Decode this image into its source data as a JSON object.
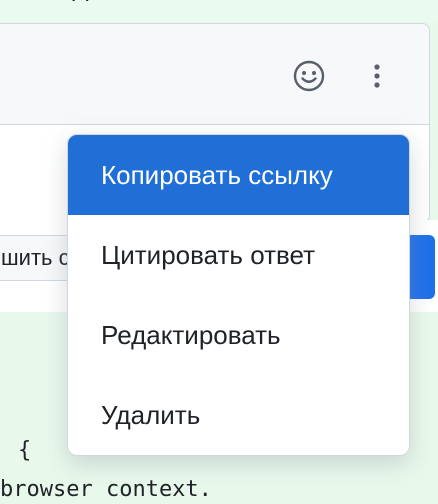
{
  "top_strip": {
    "partial_text": "· ·"
  },
  "comment_header": {
    "emoji_icon": "smiley-icon",
    "more_icon": "kebab-dots-icon"
  },
  "resolve_button": {
    "label": "шить с"
  },
  "code": {
    "line1": "{",
    "line2": "browser context."
  },
  "menu": {
    "items": [
      {
        "label": "Копировать ссылку",
        "active": true
      },
      {
        "label": "Цитировать ответ"
      },
      {
        "label": "Редактировать"
      },
      {
        "label": "Удалить"
      }
    ]
  },
  "colors": {
    "accent": "#1f6fd6",
    "primary_button": "#1f6feb",
    "diff_background": "#e8f9ec"
  }
}
